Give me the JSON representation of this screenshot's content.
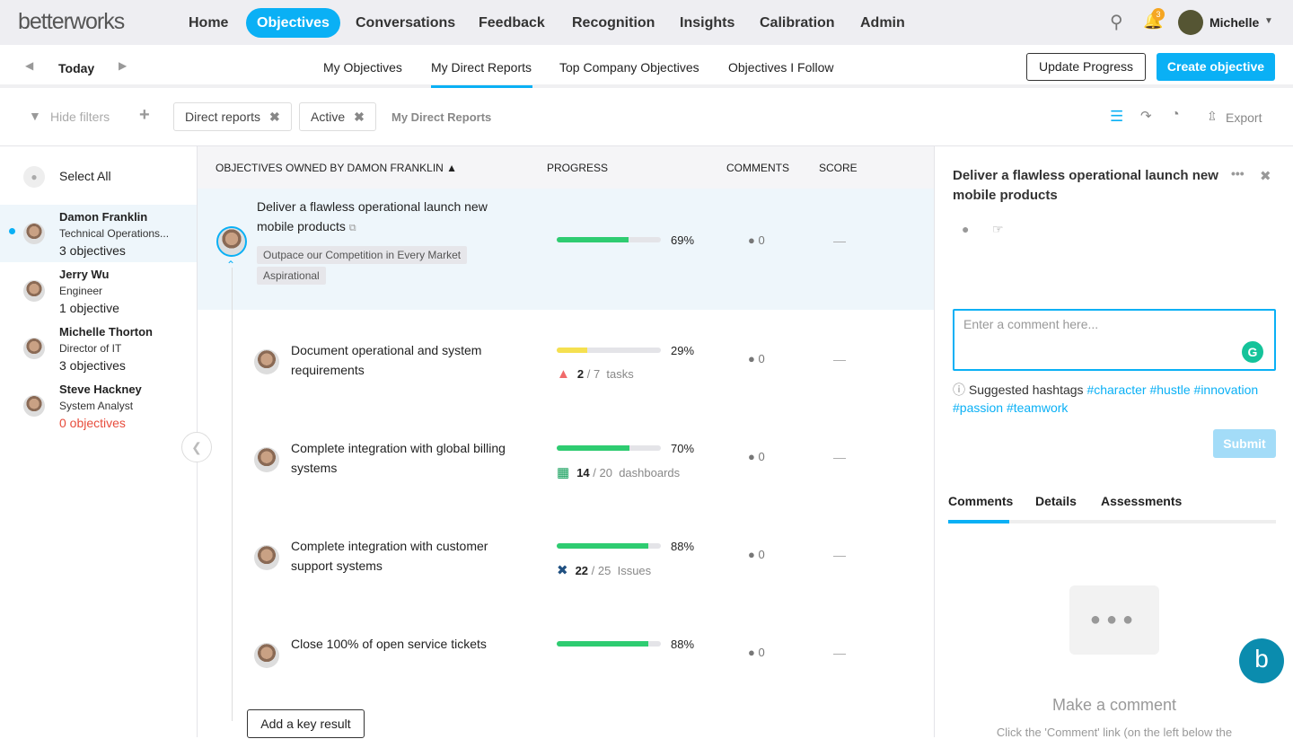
{
  "brand": "betterworks",
  "nav": [
    "Home",
    "Objectives",
    "Conversations",
    "Feedback",
    "Recognition",
    "Insights",
    "Calibration",
    "Admin"
  ],
  "nav_active": "Objectives",
  "notifications_count": "3",
  "user_name": "Michelle",
  "period": "Today",
  "tabs": [
    "My Objectives",
    "My Direct Reports",
    "Top Company Objectives",
    "Objectives I Follow"
  ],
  "active_tab": "My Direct Reports",
  "update_progress": "Update Progress",
  "create_objective": "Create objective",
  "filters": {
    "hide": "Hide filters",
    "chips": [
      "Direct reports",
      "Active"
    ],
    "view_label": "My Direct Reports",
    "export": "Export"
  },
  "sidebar": {
    "select_all": "Select All",
    "people": [
      {
        "name": "Damon Franklin",
        "role": "Technical Operations...",
        "count": "3 objectives"
      },
      {
        "name": "Jerry Wu",
        "role": "Engineer",
        "count": "1 objective"
      },
      {
        "name": "Michelle Thorton",
        "role": "Director of IT",
        "count": "3 objectives"
      },
      {
        "name": "Steve Hackney",
        "role": "System Analyst",
        "count": "0 objectives"
      }
    ]
  },
  "columns": {
    "owner": "OBJECTIVES OWNED BY DAMON FRANKLIN",
    "progress": "PROGRESS",
    "comments": "COMMENTS",
    "score": "SCORE"
  },
  "objective": {
    "title": "Deliver a flawless operational launch new mobile products",
    "progress": 69,
    "progress_label": "69%",
    "comments": "0",
    "score": "—",
    "tags": [
      "Outpace our Competition in Every Market",
      "Aspirational"
    ]
  },
  "key_results": [
    {
      "title": "Document operational and system requirements",
      "progress": 29,
      "progress_label": "29%",
      "color": "#f5e050",
      "sub_done": "2",
      "sub_total": "/ 7",
      "sub_unit": "tasks",
      "comments": "0",
      "score": "—"
    },
    {
      "title": "Complete integration with global billing systems",
      "progress": 70,
      "progress_label": "70%",
      "color": "#2ecc71",
      "sub_done": "14",
      "sub_total": "/ 20",
      "sub_unit": "dashboards",
      "comments": "0",
      "score": "—"
    },
    {
      "title": "Complete integration with customer support systems",
      "progress": 88,
      "progress_label": "88%",
      "color": "#2ecc71",
      "sub_done": "22",
      "sub_total": "/ 25",
      "sub_unit": "Issues",
      "comments": "0",
      "score": "—"
    },
    {
      "title": "Close 100% of open service tickets",
      "progress": 88,
      "progress_label": "88%",
      "color": "#2ecc71",
      "comments": "0",
      "score": "—"
    }
  ],
  "add_key_result": "Add a key result",
  "panel": {
    "title": "Deliver a flawless operational launch new mobile products",
    "comment_placeholder": "Enter a comment here...",
    "suggested": "Suggested hashtags",
    "hashtags": [
      "#character",
      "#hustle",
      "#innovation",
      "#passion",
      "#teamwork"
    ],
    "submit": "Submit",
    "tabs": [
      "Comments",
      "Details",
      "Assessments"
    ],
    "empty_title": "Make a comment",
    "empty_text": "Click the 'Comment' link (on the left below the"
  }
}
